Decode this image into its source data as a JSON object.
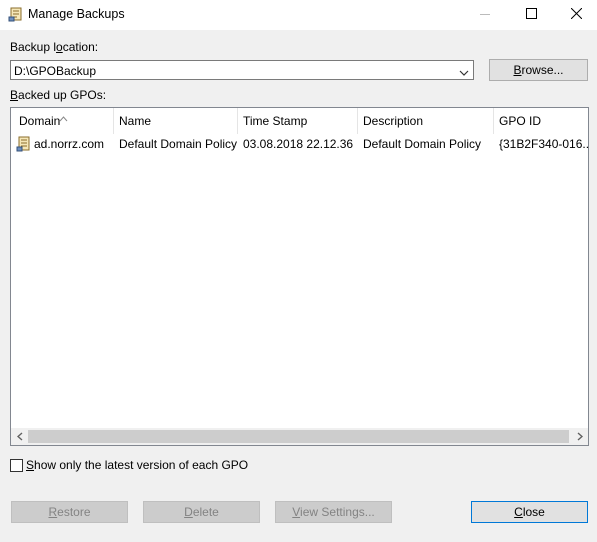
{
  "window": {
    "title": "Manage Backups"
  },
  "backup_location": {
    "label_prefix": "Backup l",
    "label_accel": "o",
    "label_suffix": "cation:",
    "value": "D:\\GPOBackup"
  },
  "browse_button": {
    "accel": "B",
    "rest": "rowse..."
  },
  "backed_up": {
    "label_accel": "B",
    "label_rest": "acked up GPOs:"
  },
  "table": {
    "columns": [
      "Domain",
      "Name",
      "Time Stamp",
      "Description",
      "GPO ID"
    ],
    "sorted_column": "Domain",
    "rows": [
      {
        "domain": "ad.norrz.com",
        "name": "Default Domain Policy",
        "time_stamp": "03.08.2018 22.12.36",
        "description": "Default Domain Policy",
        "gpo_id": "{31B2F340-016..."
      }
    ]
  },
  "latest_only": {
    "accel": "S",
    "rest": "how only the latest version of each GPO",
    "checked": false
  },
  "buttons": {
    "restore": {
      "accel": "R",
      "rest": "estore",
      "enabled": false
    },
    "delete": {
      "accel": "D",
      "rest": "elete",
      "enabled": false
    },
    "view_settings": {
      "accel": "V",
      "rest": "iew Settings...",
      "enabled": false
    },
    "close": {
      "accel": "C",
      "rest": "lose",
      "enabled": true
    }
  },
  "icons": {
    "app": "scroll-document-icon",
    "row": "gpo-scroll-icon"
  },
  "colors": {
    "window_bg": "#f0f0f0",
    "focus_border": "#0078d7"
  }
}
